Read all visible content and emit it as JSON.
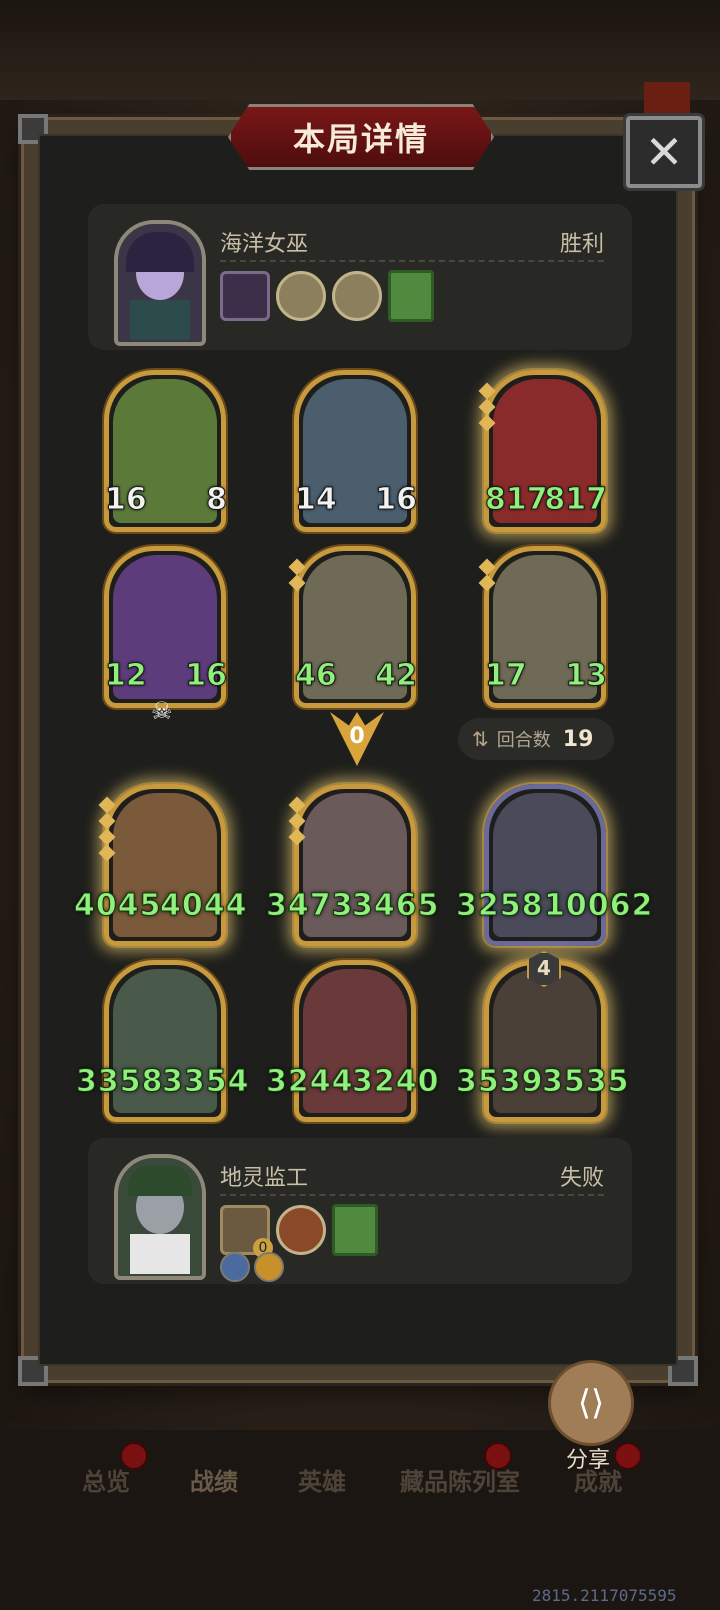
{
  "title": "本局详情",
  "close_glyph": "✕",
  "top_player": {
    "name": "海洋女巫",
    "result": "胜利"
  },
  "top_board": [
    {
      "atk": "16",
      "hp": "8",
      "color": "#5b7a3a"
    },
    {
      "atk": "14",
      "hp": "16",
      "color": "#4a5e6e"
    },
    {
      "atk": "817",
      "hp": "817",
      "color": "#8a2b2b"
    },
    {
      "atk": "12",
      "hp": "16",
      "color": "#5c3c7a"
    },
    {
      "atk": "46",
      "hp": "42",
      "color": "#6e6a55"
    },
    {
      "atk": "17",
      "hp": "13",
      "color": "#6e6a55"
    }
  ],
  "turn_arrow_value": "0",
  "turns": {
    "label": "回合数",
    "value": "19"
  },
  "bottom_board": [
    {
      "atk": "4045",
      "hp": "4044",
      "color": "#7a5a3a"
    },
    {
      "atk": "3473",
      "hp": "3465",
      "color": "#6a5a5a"
    },
    {
      "atk": "3258",
      "hp": "10062",
      "color": "#4a4a5a"
    },
    {
      "atk": "3358",
      "hp": "3354",
      "color": "#4a5a4a"
    },
    {
      "atk": "3244",
      "hp": "3240",
      "color": "#6a3a3a"
    },
    {
      "atk": "3539",
      "hp": "3535",
      "color": "#4a4038"
    }
  ],
  "tier_badge": "4",
  "bottom_player": {
    "name": "地灵监工",
    "result": "失败",
    "item_count": "0"
  },
  "share_label": "分享",
  "nav": [
    "总览",
    "战绩",
    "英雄",
    "藏品陈列室",
    "成就"
  ],
  "coords_readout": "2815.2117075595"
}
